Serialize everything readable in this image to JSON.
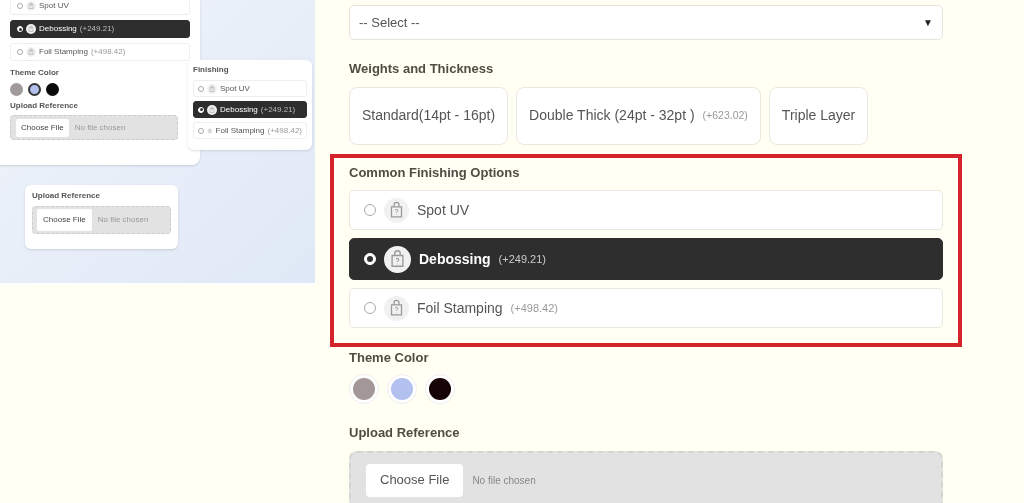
{
  "preview": {
    "main_card": {
      "options": [
        {
          "name": "Spot UV",
          "selected": false
        },
        {
          "name": "Debossing",
          "price": "(+249.21)",
          "selected": true
        },
        {
          "name": "Foil Stamping",
          "price": "(+498.42)",
          "selected": false
        }
      ],
      "theme_color": {
        "label": "Theme Color",
        "swatches": [
          {
            "color": "#a09a9a",
            "selected": false
          },
          {
            "color": "#b4c0ec",
            "selected": true
          },
          {
            "color": "#0a0a0a",
            "selected": false
          }
        ]
      },
      "upload": {
        "label": "Upload Reference",
        "button": "Choose File",
        "status": "No file chosen"
      }
    },
    "finishing_card": {
      "title": "Finishing",
      "options": [
        {
          "name": "Spot UV",
          "selected": false
        },
        {
          "name": "Debossing",
          "price": "(+249.21)",
          "selected": true
        },
        {
          "name": "Foil Stamping",
          "price": "(+498.42)",
          "selected": false
        }
      ]
    },
    "upload_card": {
      "label": "Upload Reference",
      "button": "Choose File",
      "status": "No file chosen"
    }
  },
  "form": {
    "select": {
      "placeholder": "-- Select --",
      "arrow": "▼"
    },
    "thickness": {
      "label": "Weights and Thickness",
      "options": [
        {
          "name": "Standard(14pt - 16pt)"
        },
        {
          "name": "Double Thick (24pt - 32pt )",
          "price": "(+623.02)"
        },
        {
          "name": "Triple Layer"
        }
      ]
    },
    "finishing": {
      "label": "Common Finishing Options",
      "highlighted": true,
      "options": [
        {
          "name": "Spot UV",
          "selected": false
        },
        {
          "name": "Debossing",
          "price": "(+249.21)",
          "selected": true
        },
        {
          "name": "Foil Stamping",
          "price": "(+498.42)",
          "selected": false
        }
      ]
    },
    "theme_color": {
      "label": "Theme Color",
      "swatches": [
        {
          "color": "#a39797",
          "selected": false
        },
        {
          "color": "#b3c1ee",
          "selected": false
        },
        {
          "color": "#160306",
          "selected": false
        }
      ]
    },
    "upload": {
      "label": "Upload Reference",
      "button": "Choose File",
      "status": "No file chosen"
    }
  }
}
